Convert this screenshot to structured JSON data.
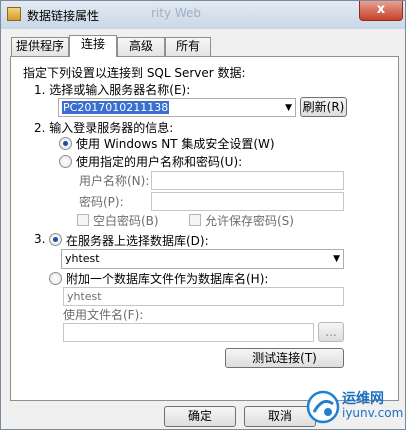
{
  "window": {
    "title": "数据链接属性",
    "ghost_text": "rity   Web",
    "close_label": "x"
  },
  "tabs": [
    "提供程序",
    "连接",
    "高级",
    "所有"
  ],
  "intro": "指定下列设置以连接到 SQL Server 数据:",
  "step1": {
    "label": "1. 选择或输入服务器名称(E):",
    "server_value": "PC2017010211138",
    "refresh_label": "刷新(R)"
  },
  "step2": {
    "label": "2. 输入登录服务器的信息:",
    "opt_windows": "使用 Windows NT 集成安全设置(W)",
    "opt_specific": "使用指定的用户名称和密码(U):",
    "username_label": "用户名称(N):",
    "password_label": "密码(P):",
    "blank_pw_label": "空白密码(B)",
    "save_pw_label": "允许保存密码(S)"
  },
  "step3": {
    "prefix": "3.",
    "opt_select_db": "在服务器上选择数据库(D):",
    "db_value": "yhtest",
    "opt_attach": "附加一个数据库文件作为数据库名(H):",
    "attach_name": "yhtest",
    "filename_label": "使用文件名(F):",
    "browse_label": "..."
  },
  "test_button": "测试连接(T)",
  "footer": {
    "ok": "确定",
    "cancel": "取消"
  },
  "watermark": {
    "line1": "运维网",
    "line2": "iyunv.com"
  }
}
